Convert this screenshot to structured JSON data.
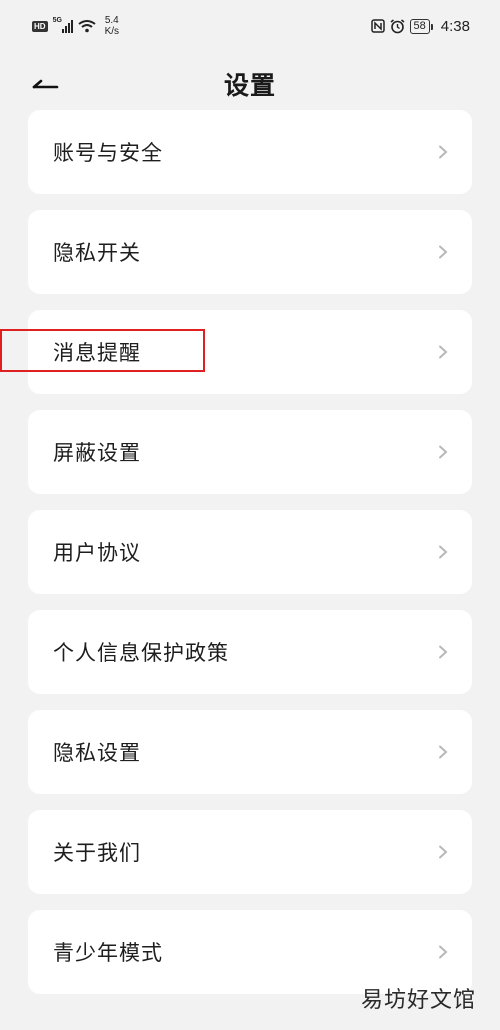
{
  "status_bar": {
    "hd": "HD",
    "signal_label": "5G",
    "net_speed_value": "5.4",
    "net_speed_unit": "K/s",
    "battery": "58",
    "time": "4:38",
    "icons": [
      "hd-icon",
      "signal-icon",
      "wifi-icon",
      "nfc-icon",
      "alarm-icon",
      "battery-icon"
    ]
  },
  "header": {
    "title": "设置",
    "back_icon": "back-arrow-icon"
  },
  "settings": {
    "items": [
      {
        "label": "账号与安全"
      },
      {
        "label": "隐私开关"
      },
      {
        "label": "消息提醒"
      },
      {
        "label": "屏蔽设置"
      },
      {
        "label": "用户协议"
      },
      {
        "label": "个人信息保护政策"
      },
      {
        "label": "隐私设置"
      },
      {
        "label": "关于我们"
      },
      {
        "label": "青少年模式"
      }
    ],
    "chevron_icon": "chevron-right-icon"
  },
  "watermark": "易坊好文馆",
  "colors": {
    "background": "#f2f2f2",
    "card": "#ffffff",
    "text": "#1e1e1e",
    "chevron": "#b8b8b8",
    "highlight": "#e02020"
  }
}
